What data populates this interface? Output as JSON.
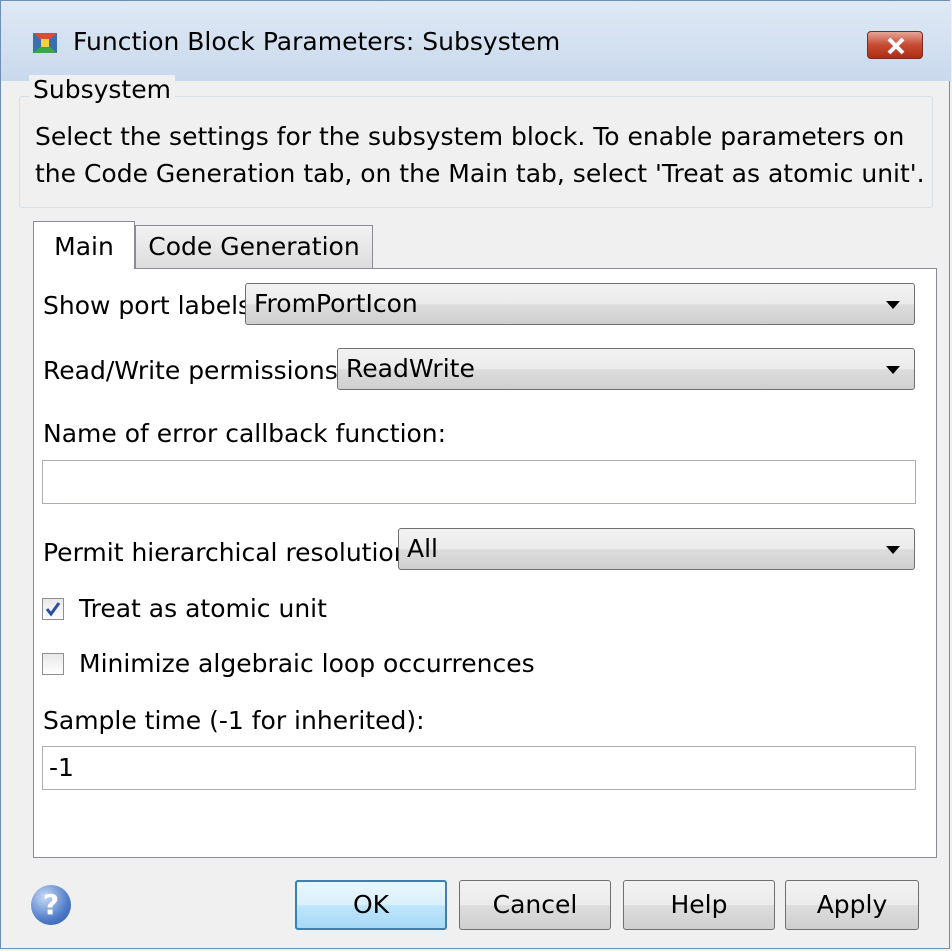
{
  "window": {
    "title": "Function Block Parameters: Subsystem",
    "icon": "simulink-block-icon",
    "close": "close-icon"
  },
  "description": {
    "group_label": "Subsystem",
    "text": "Select the settings for the subsystem block. To enable parameters on the Code Generation tab, on the Main tab, select 'Treat as atomic unit'."
  },
  "tabs": [
    {
      "label": "Main",
      "active": true
    },
    {
      "label": "Code Generation",
      "active": false
    }
  ],
  "main": {
    "show_port_labels": {
      "label": "Show port labels",
      "value": "FromPortIcon"
    },
    "read_write": {
      "label": "Read/Write permissions:",
      "value": "ReadWrite"
    },
    "error_callback": {
      "label": "Name of error callback function:",
      "value": ""
    },
    "hierarchical": {
      "label": "Permit hierarchical resolution:",
      "value": "All"
    },
    "atomic": {
      "label": "Treat as atomic unit",
      "checked": true
    },
    "minimize": {
      "label": "Minimize algebraic loop occurrences",
      "checked": false
    },
    "sample_time": {
      "label": "Sample time (-1 for inherited):",
      "value": "-1"
    }
  },
  "buttons": {
    "help_icon": "?",
    "ok": "OK",
    "cancel": "Cancel",
    "help": "Help",
    "apply": "Apply"
  },
  "colors": {
    "accent": "#3c7fb1",
    "close": "#c64a32"
  }
}
